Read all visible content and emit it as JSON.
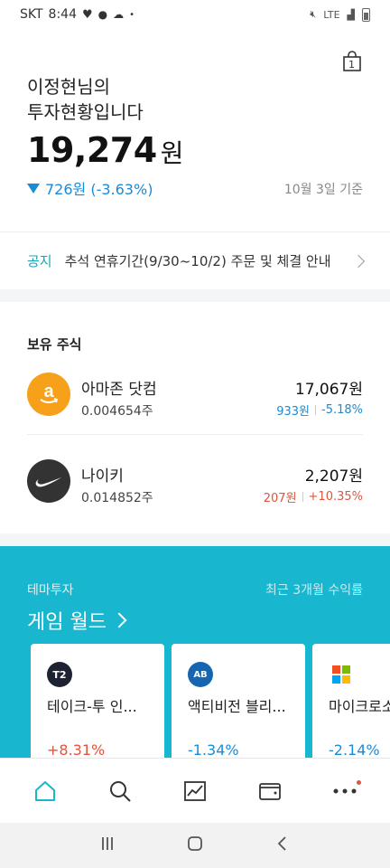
{
  "status": {
    "carrier": "SKT",
    "time": "8:44",
    "network": "LTE"
  },
  "summary": {
    "greeting_line1": "이정현님의",
    "greeting_line2": "투자현황입니다",
    "total_amount": "19,274",
    "total_unit": "원",
    "change_text": "726원 (-3.63%)",
    "as_of": "10월 3일 기준",
    "cart_count": "1"
  },
  "notice": {
    "tag": "공지",
    "text": "추석 연휴기간(9/30~10/2) 주문 및 체결 안내"
  },
  "holdings": {
    "title": "보유 주식",
    "items": [
      {
        "name": "아마존 닷컴",
        "qty": "0.004654주",
        "value": "17,067원",
        "change_amt": "933원",
        "change_pct": "-5.18%",
        "direction": "down"
      },
      {
        "name": "나이키",
        "qty": "0.014852주",
        "value": "2,207원",
        "change_amt": "207원",
        "change_pct": "+10.35%",
        "direction": "up"
      }
    ]
  },
  "theme": {
    "label": "테마투자",
    "period": "최근 3개월 수익률",
    "title": "게임 월드",
    "cards": [
      {
        "name": "테이크-투 인...",
        "rate": "+8.31%",
        "direction": "up",
        "logo": "T2"
      },
      {
        "name": "액티비전 블리...",
        "rate": "-1.34%",
        "direction": "down",
        "logo": "AB"
      },
      {
        "name": "마이크로소프트",
        "rate": "-2.14%",
        "direction": "down",
        "logo": "MS"
      }
    ]
  },
  "colors": {
    "accent": "#19b6cf",
    "down": "#1a8bd6",
    "up": "#e0533e"
  },
  "nav": {
    "items": [
      "home-icon",
      "search-icon",
      "chart-icon",
      "wallet-icon",
      "more-icon"
    ]
  }
}
